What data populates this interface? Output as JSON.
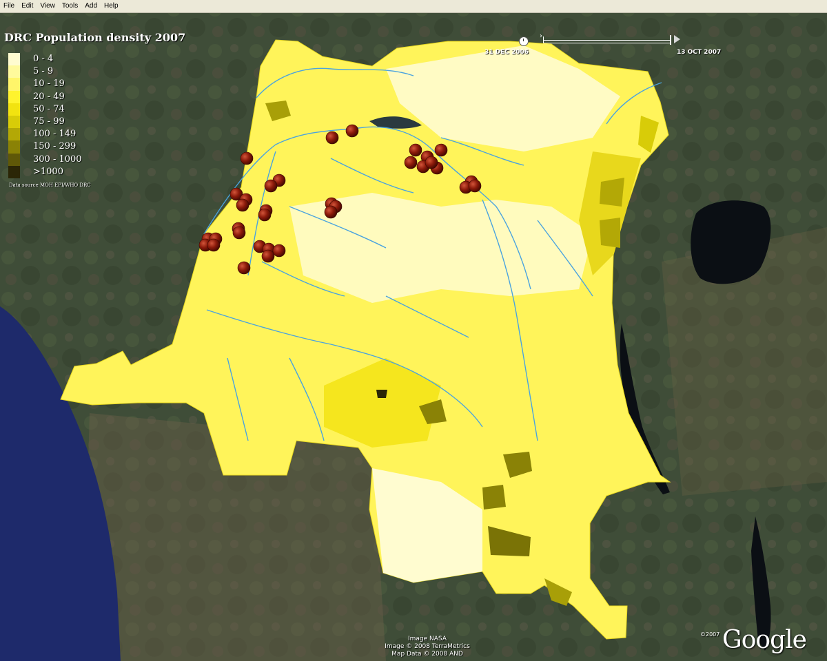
{
  "menu": {
    "items": [
      "File",
      "Edit",
      "View",
      "Tools",
      "Add",
      "Help"
    ]
  },
  "overlay": {
    "title": "DRC Population density 2007",
    "legend": [
      {
        "label": "0 - 4",
        "color": "#fffcd0"
      },
      {
        "label": "5 - 9",
        "color": "#fffa9c"
      },
      {
        "label": "10 - 19",
        "color": "#fff56a"
      },
      {
        "label": "20 - 49",
        "color": "#fff32e"
      },
      {
        "label": "50 - 74",
        "color": "#f2e310"
      },
      {
        "label": "75 - 99",
        "color": "#d8cc08"
      },
      {
        "label": "100 - 149",
        "color": "#b3a806"
      },
      {
        "label": "150 - 299",
        "color": "#8a8206"
      },
      {
        "label": "300 - 1000",
        "color": "#5f5808"
      },
      {
        "label": ">1000",
        "color": "#2b2606"
      }
    ],
    "source": "Data source MOH EPI/WHO DRC"
  },
  "time_slider": {
    "start_date": "31 DEC 2006",
    "end_date": "13 OCT 2007"
  },
  "attribution": {
    "line1": "Image NASA",
    "line2": "Image © 2008 TerraMetrics",
    "line3": "Map Data © 2008 AND"
  },
  "brand": {
    "copyright": "©2007",
    "logo": "Google"
  },
  "colors": {
    "marker": "#8b1a0a",
    "river": "#4aa3df",
    "ocean": "#1e2a6b"
  }
}
